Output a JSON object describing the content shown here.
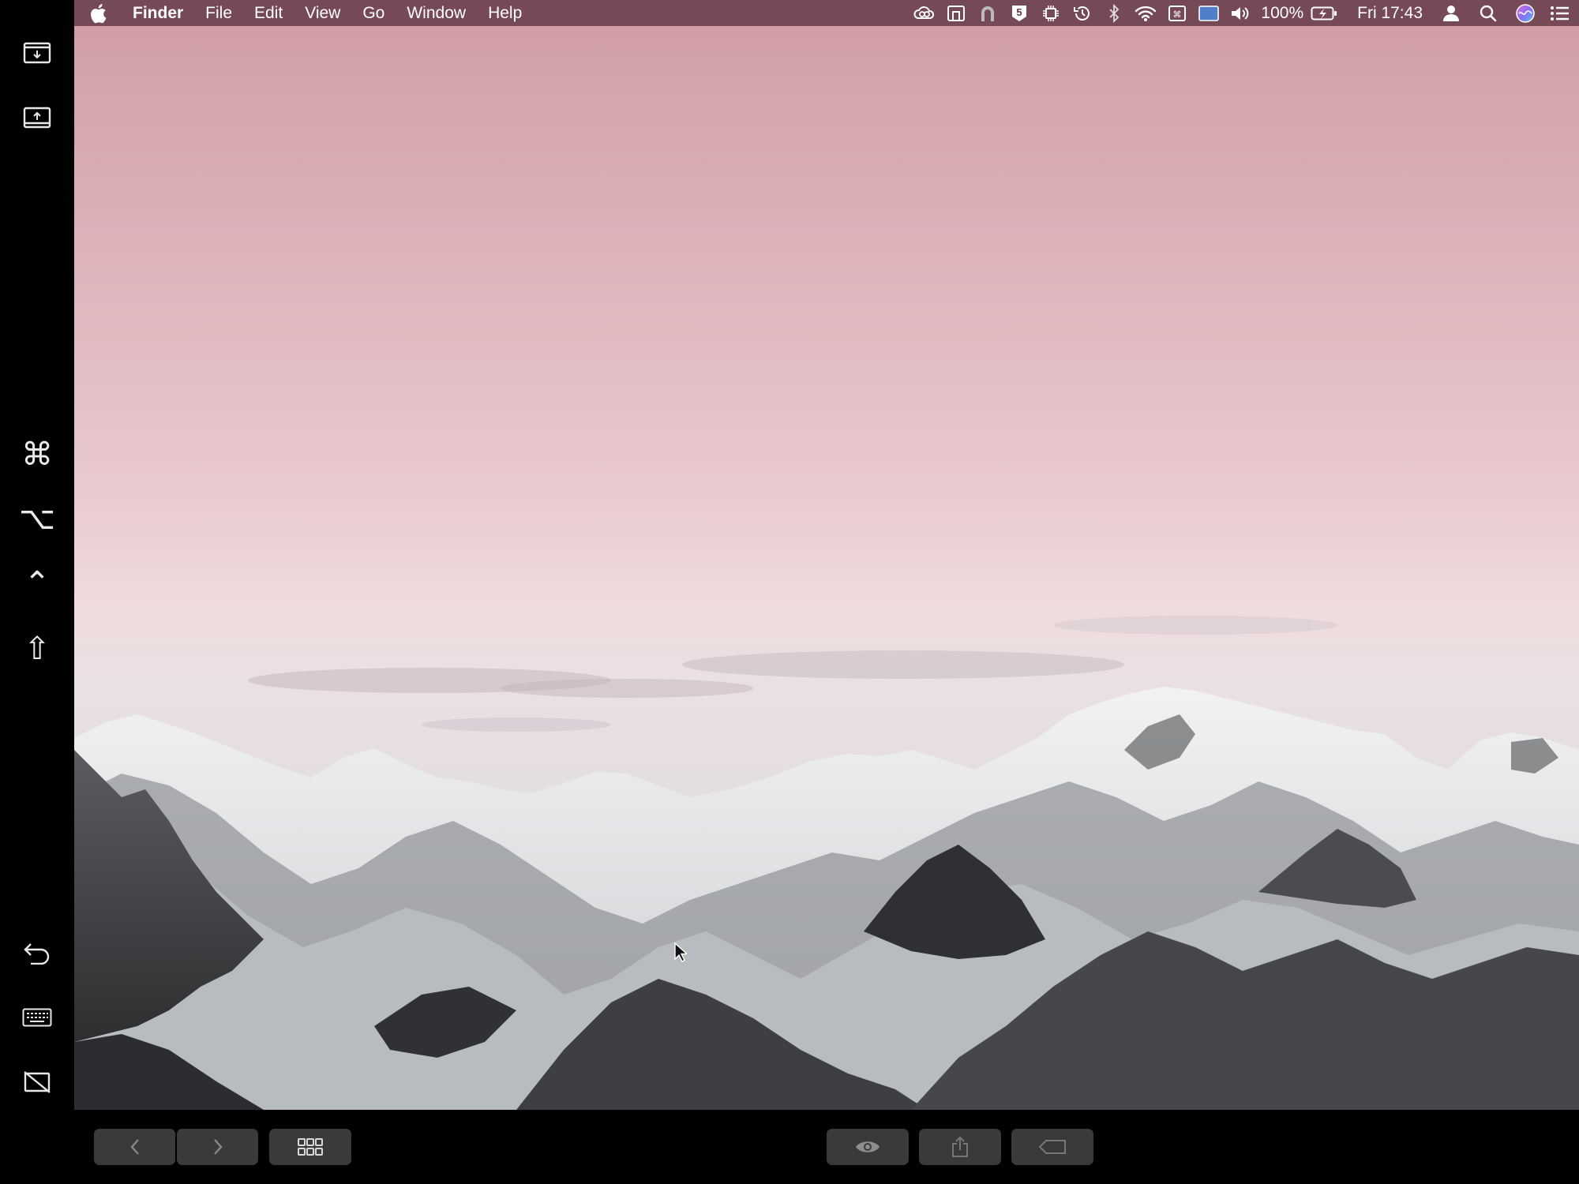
{
  "menubar": {
    "app_name": "Finder",
    "menus": [
      "File",
      "Edit",
      "View",
      "Go",
      "Window",
      "Help"
    ],
    "status": {
      "battery_percent": "100%",
      "clock": "Fri 17:43"
    }
  },
  "sidebar": {
    "top_icons": [
      "screen-download-icon",
      "screen-upload-icon"
    ],
    "modifier_keys": {
      "command": "⌘",
      "option": "⌥",
      "control": "⌃",
      "shift": "⇧"
    },
    "bottom_icons": [
      "undo-icon",
      "keyboard-icon",
      "hide-display-icon"
    ]
  },
  "touchbar": {
    "buttons": [
      "back-icon",
      "forward-icon",
      "grid-view-icon",
      "quick-look-icon",
      "share-icon",
      "tag-icon"
    ]
  },
  "colors": {
    "menubar_bg": "#60374480",
    "sky_top": "#cf9ba3",
    "sky_horizon": "#efdcdd",
    "touchbar_button": "#3a3a3c"
  }
}
